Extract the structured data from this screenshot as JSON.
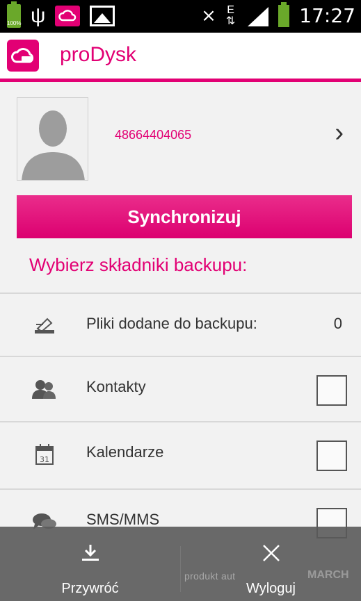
{
  "status_bar": {
    "battery_percent": "100%",
    "data_type": "E",
    "time": "17:27"
  },
  "app": {
    "title": "proDysk",
    "accent_color": "#e20074"
  },
  "profile": {
    "phone": "48664404065"
  },
  "sync_button_label": "Synchronizuj",
  "section_title": "Wybierz składniki backupu:",
  "backup_items": [
    {
      "label": "Pliki dodane do backupu:",
      "count": "0",
      "icon": "files-icon"
    },
    {
      "label": "Kontakty",
      "checked": false,
      "icon": "contacts-icon"
    },
    {
      "label": "Kalendarze",
      "checked": false,
      "icon": "calendar-icon"
    },
    {
      "label": "SMS/MMS",
      "checked": false,
      "icon": "sms-icon"
    }
  ],
  "bottom_bar": {
    "restore_label": "Przywróć",
    "logout_label": "Wyloguj",
    "watermark_left": "produkt aut",
    "watermark_right": "MARCH"
  }
}
